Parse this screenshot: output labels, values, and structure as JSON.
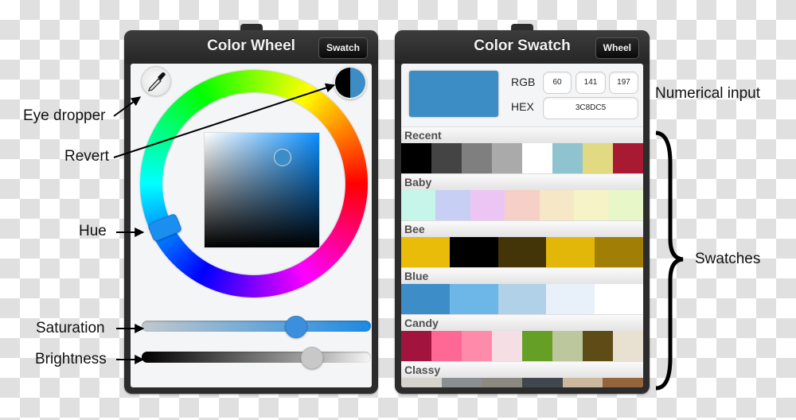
{
  "wheel_panel": {
    "title": "Color Wheel",
    "switch_button": "Swatch",
    "revert_colors": {
      "previous": "#000000",
      "current": "#3c8dc5"
    },
    "saturation_value": 0.67,
    "brightness_value": 0.74
  },
  "swatch_panel": {
    "title": "Color Swatch",
    "switch_button": "Wheel",
    "preview_color": "#3c8dc5",
    "rgb_label": "RGB",
    "hex_label": "HEX",
    "rgb": {
      "r": "60",
      "g": "141",
      "b": "197"
    },
    "hex": "3C8DC5",
    "groups": [
      {
        "name": "Recent",
        "colors": [
          "#000000",
          "#444444",
          "#7f7f7f",
          "#aaaaaa",
          "#ffffff",
          "#8fc3d0",
          "#e2d983",
          "#a81a31"
        ]
      },
      {
        "name": "Baby",
        "colors": [
          "#c6f5ea",
          "#c8cff5",
          "#ecc5f4",
          "#f6d0c6",
          "#f6e8c6",
          "#f6f3c6",
          "#e8f7c8"
        ]
      },
      {
        "name": "Bee",
        "colors": [
          "#e9bc09",
          "#000000",
          "#433508",
          "#e2b709",
          "#a17e06"
        ]
      },
      {
        "name": "Blue",
        "colors": [
          "#3d8dc8",
          "#6db6e8",
          "#b0d1e7",
          "#e8f1fa",
          "#ffffff"
        ]
      },
      {
        "name": "Candy",
        "colors": [
          "#a2133e",
          "#ff6895",
          "#ff8baa",
          "#f5dfe5",
          "#659f26",
          "#bdc79e",
          "#5e4c16",
          "#e8e0d1"
        ]
      },
      {
        "name": "Classy",
        "colors": [
          "#d6d2cc",
          "#8a8f94",
          "#8c8981",
          "#41474e",
          "#cbb89d",
          "#94643c"
        ]
      }
    ]
  },
  "annotations": {
    "eye_dropper": "Eye dropper",
    "revert": "Revert",
    "hue": "Hue",
    "saturation": "Saturation",
    "brightness": "Brightness",
    "numerical_input": "Numerical input",
    "swatches": "Swatches"
  }
}
